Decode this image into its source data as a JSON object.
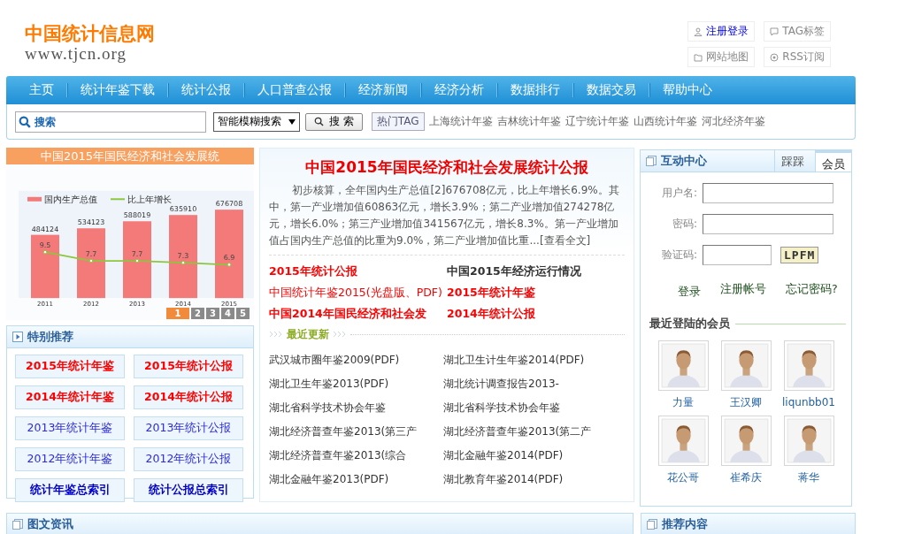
{
  "header": {
    "logo_title": "中国统计信息网",
    "logo_url": "www.tjcn.org",
    "links": [
      {
        "label": "注册登录",
        "highlighted": true
      },
      {
        "label": "TAG标签",
        "highlighted": false
      },
      {
        "label": "网站地图",
        "highlighted": false
      },
      {
        "label": "RSS订阅",
        "highlighted": false
      }
    ]
  },
  "nav": [
    "主页",
    "统计年鉴下载",
    "统计公报",
    "人口普查公报",
    "经济新闻",
    "经济分析",
    "数据排行",
    "数据交易",
    "帮助中心"
  ],
  "search": {
    "placeholder": "搜索",
    "mode": "智能模糊搜索",
    "button": "搜 索",
    "hot_label": "热门TAG",
    "hot_tags": [
      "上海统计年鉴",
      "吉林统计年鉴",
      "辽宁统计年鉴",
      "山西统计年鉴",
      "河北经济年鉴"
    ]
  },
  "slideshow": {
    "caption": "中国2015年国民经济和社会发展统",
    "chart_data": {
      "type": "bar",
      "categories": [
        "2011",
        "2012",
        "2013",
        "2014",
        "2015"
      ],
      "data_labels": true,
      "series": [
        {
          "name": "国内生产总值",
          "color": "#f47a7a",
          "values": [
            484124,
            534123,
            588019,
            635910,
            676708
          ]
        }
      ]
    },
    "growth_line": {
      "name": "比上年增长",
      "color": "#8cc63f",
      "labels": [
        "9.5",
        "7.7",
        "7.7",
        "7.3",
        "6.9"
      ]
    },
    "pager": [
      {
        "label": "1",
        "selected": true
      },
      {
        "label": "2",
        "selected": false
      },
      {
        "label": "3",
        "selected": false
      },
      {
        "label": "4",
        "selected": false
      },
      {
        "label": "5",
        "selected": false
      }
    ]
  },
  "featured": {
    "title": "特别推荐",
    "links": [
      {
        "label": "2015年统计年鉴",
        "color": "#ff0000",
        "bold": true
      },
      {
        "label": "2015年统计公报",
        "color": "#ff0000",
        "bold": true
      },
      {
        "label": "2014年统计年鉴",
        "color": "#ff0000",
        "bold": true
      },
      {
        "label": "2014年统计公报",
        "color": "#ff0000",
        "bold": true
      },
      {
        "label": "2013年统计年鉴",
        "color": "#2b2bdd",
        "bold": false
      },
      {
        "label": "2013年统计公报",
        "color": "#2b2bdd",
        "bold": false
      },
      {
        "label": "2012年统计年鉴",
        "color": "#2b2bdd",
        "bold": false
      },
      {
        "label": "2012年统计公报",
        "color": "#2b2bdd",
        "bold": false
      },
      {
        "label": "统计年鉴总索引",
        "color": "#0000cc",
        "bold": true
      },
      {
        "label": "统计公报总索引",
        "color": "#0000cc",
        "bold": true
      }
    ]
  },
  "headline": {
    "title": "中国2015年国民经济和社会发展统计公报",
    "summary": "初步核算，全年国内生产总值[2]676708亿元，比上年增长6.9%。其中，第一产业增加值60863亿元，增长3.9%；第二产业增加值274278亿元，增长6.0%；第三产业增加值341567亿元，增长8.3%。第一产业增加值占国内生产总值的比重为9.0%，第二产业增加值比重...",
    "more": "[查看全文]",
    "links": [
      {
        "label": "2015年统计公报",
        "color": "#ff0000",
        "bold": true
      },
      {
        "label": "中国2015年经济运行情况",
        "color": "#333333",
        "bold": true
      },
      {
        "label": "中国统计年鉴2015(光盘版、PDF)",
        "color": "#ff0000",
        "bold": false
      },
      {
        "label": "2015年统计年鉴",
        "color": "#ff0000",
        "bold": true
      },
      {
        "label": "中国2014年国民经济和社会发",
        "color": "#ff0000",
        "bold": true
      },
      {
        "label": "2014年统计公报",
        "color": "#ff0000",
        "bold": true
      }
    ]
  },
  "recent": {
    "title": "最近更新",
    "items": [
      "武汉城市圈年鉴2009(PDF)",
      "湖北卫生计生年鉴2014(PDF)",
      "湖北卫生年鉴2013(PDF)",
      "湖北统计调查报告2013-",
      "湖北省科学技术协会年鉴",
      "湖北省科学技术协会年鉴",
      "湖北经济普查年鉴2013(第三产",
      "湖北经济普查年鉴2013(第二产",
      "湖北经济普查年鉴2013(综合",
      "湖北金融年鉴2014(PDF)",
      "湖北金融年鉴2013(PDF)",
      "湖北教育年鉴2014(PDF)"
    ]
  },
  "interaction": {
    "title": "互动中心",
    "tabs": [
      {
        "label": "踩踩",
        "selected": false
      },
      {
        "label": "会员",
        "selected": true
      }
    ],
    "fields": [
      "用户名:",
      "密码:",
      "验证码:"
    ],
    "captcha": "LPFM",
    "actions": [
      "登录",
      "注册帐号",
      "忘记密码?"
    ],
    "members_title": "最近登陆的会员",
    "members": [
      "力量",
      "王汉卿",
      "liqunbb01",
      "花公哥",
      "崔希庆",
      "蒋华"
    ]
  },
  "bottom": {
    "left_title": "图文资讯",
    "right_title": "推荐内容"
  }
}
